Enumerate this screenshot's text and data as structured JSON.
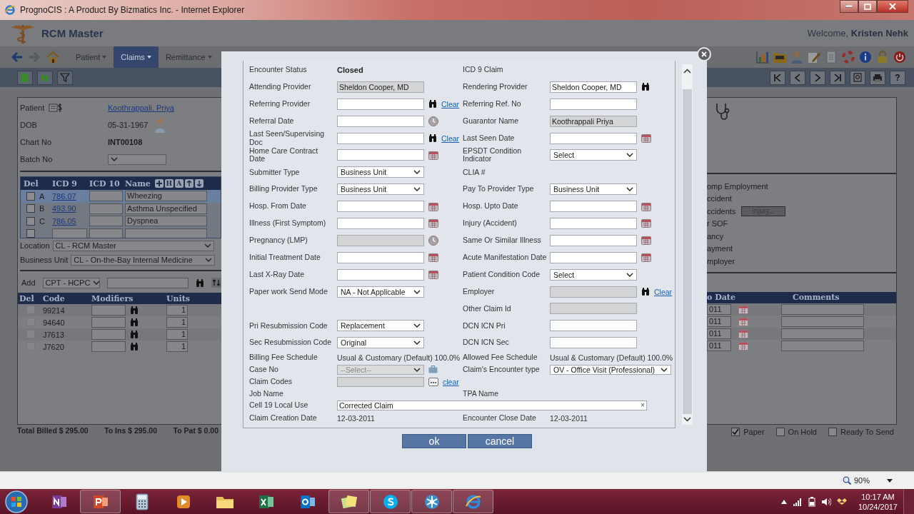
{
  "window": {
    "title": "PrognoCIS : A Product By Bizmatics Inc. - Internet Explorer"
  },
  "header": {
    "app_title": "RCM Master",
    "welcome": "Welcome, **Kristen Nehk**"
  },
  "menus": [
    {
      "label": "Patient",
      "selected": false
    },
    {
      "label": "Claims",
      "selected": true
    },
    {
      "label": "Remittance",
      "selected": false
    }
  ],
  "toolbar": {
    "help": "?"
  },
  "patient": {
    "fields": [
      {
        "label": "Patient",
        "kind": "link",
        "value": "Koothrappali, Priya"
      },
      {
        "label": "DOB",
        "kind": "text",
        "value": "05-31-1967"
      },
      {
        "label": "Chart No",
        "kind": "strong",
        "value": "INT00108"
      },
      {
        "label": "Batch No",
        "kind": "select"
      }
    ]
  },
  "diagnoses": {
    "columns": [
      "Del",
      "ICD 9",
      "ICD 10",
      "Name"
    ],
    "header_buttons": [
      "H",
      "A"
    ],
    "rows": [
      {
        "letter": "A",
        "code": "786.07",
        "name": "Wheezing",
        "selected": true,
        "checked": false
      },
      {
        "letter": "B",
        "code": "493.90",
        "name": "Asthma Unspecified",
        "selected": false,
        "checked": false
      },
      {
        "letter": "C",
        "code": "786.05",
        "name": "Dyspnea",
        "selected": false,
        "checked": false
      },
      {
        "selected": false,
        "checked": false
      }
    ]
  },
  "location": {
    "label": "Location",
    "value": "CL - RCM Master"
  },
  "business_unit": {
    "label": "Business Unit",
    "value": "CL - On-the-Bay Internal Medicine"
  },
  "add": {
    "label": "Add",
    "value": "CPT - HCPC"
  },
  "procedures": {
    "columns": [
      "Del",
      "Code",
      "Modifiers",
      "Units"
    ],
    "rows": [
      {
        "code": "99214",
        "units": "1",
        "checked": false
      },
      {
        "code": "94640",
        "units": "1",
        "checked": false
      },
      {
        "code": "J7613",
        "units": "1",
        "checked": false
      },
      {
        "code": "J7620",
        "units": "1",
        "checked": false
      }
    ]
  },
  "totals": [
    "Total Billed $ 295.00",
    "To Ins $ 295.00",
    "To Pat $ 0.00"
  ],
  "claim_info": {
    "items": [
      {
        "text": "omp Employment"
      },
      {
        "text": "ccident"
      },
      {
        "text": "ccidents",
        "button": "injury..."
      },
      {
        "text": "r SOF"
      },
      {
        "text": "ancy"
      },
      {
        "text": "ayment"
      },
      {
        "text": "mployer"
      }
    ]
  },
  "service_lines": {
    "columns": [
      "o Date",
      "Comments"
    ],
    "rows": [
      {
        "to_date": "011"
      },
      {
        "to_date": "011"
      },
      {
        "to_date": "011"
      },
      {
        "to_date": "011"
      }
    ]
  },
  "flags": [
    {
      "label": "Paper",
      "checked": true
    },
    {
      "label": "On Hold",
      "checked": false
    },
    {
      "label": "Ready To Send",
      "checked": false
    }
  ],
  "dialog": {
    "form": {
      "rows": [
        {
          "left": {
            "label": "Encounter Status",
            "kind": "strong",
            "value": "Closed"
          },
          "right": {
            "label": "ICD 9 Claim",
            "kind": "label"
          }
        },
        {
          "left": {
            "label": "Attending Provider",
            "kind": "input",
            "value": "Sheldon Cooper, MD",
            "disabled": true
          },
          "right": {
            "label": "Rendering Provider",
            "kind": "input",
            "value": "Sheldon Cooper, MD",
            "disabled": false,
            "lookup": true
          }
        },
        {
          "left": {
            "label": "Referring Provider",
            "kind": "input",
            "disabled": false,
            "lookup": true,
            "link": "Clear"
          },
          "right": {
            "label": "Referring Ref. No",
            "kind": "input",
            "disabled": false
          }
        },
        {
          "left": {
            "label": "Referral Date",
            "kind": "input",
            "disabled": false,
            "clock": true
          },
          "right": {
            "label": "Guarantor Name",
            "kind": "input",
            "value": "Koothrappali Priya",
            "disabled": true
          }
        },
        {
          "left": {
            "label": "Last Seen/Supervising Doc",
            "kind": "input",
            "disabled": false,
            "lookup": true,
            "link": "Clear"
          },
          "right": {
            "label": "Last Seen Date",
            "kind": "input",
            "disabled": false,
            "calendar": true
          }
        },
        {
          "left": {
            "label": "Home Care Contract Date",
            "kind": "input",
            "disabled": false,
            "calendar": true
          },
          "right": {
            "label": "EPSDT Condition Indicator",
            "kind": "select",
            "value": "Select",
            "disabled": false
          }
        },
        {
          "left": {
            "label": "Submitter Type",
            "kind": "select",
            "value": "Business Unit",
            "disabled": false
          },
          "right": {
            "label": "CLIA #",
            "kind": "label"
          }
        },
        {
          "left": {
            "label": "Billing Provider Type",
            "kind": "select",
            "value": "Business Unit",
            "disabled": false
          },
          "right": {
            "label": "Pay To Provider Type",
            "kind": "select",
            "value": "Business Unit",
            "disabled": false
          }
        },
        {
          "left": {
            "label": "Hosp. From Date",
            "kind": "input",
            "disabled": false,
            "calendar": true
          },
          "right": {
            "label": "Hosp. Upto Date",
            "kind": "input",
            "disabled": false,
            "calendar": true
          }
        },
        {
          "left": {
            "label": "Illness (First Symptom)",
            "kind": "input",
            "disabled": false,
            "calendar": true
          },
          "right": {
            "label": "Injury (Accident)",
            "kind": "input",
            "disabled": false,
            "calendar": true
          }
        },
        {
          "left": {
            "label": "Pregnancy (LMP)",
            "kind": "input",
            "disabled": true,
            "clock": true
          },
          "right": {
            "label": "Same Or Similar Illness",
            "kind": "input",
            "disabled": false,
            "calendar": true
          }
        },
        {
          "left": {
            "label": "Initial Treatment Date",
            "kind": "input",
            "disabled": false,
            "calendar": true
          },
          "right": {
            "label": "Acute Manifestation Date",
            "kind": "input",
            "disabled": false,
            "calendar": true
          }
        },
        {
          "left": {
            "label": "Last X-Ray Date",
            "kind": "input",
            "disabled": false,
            "calendar": true
          },
          "right": {
            "label": "Patient Condition Code",
            "kind": "select",
            "value": "Select",
            "disabled": false
          }
        },
        {
          "left": {
            "label": "Paper work Send Mode",
            "kind": "select",
            "value": "NA - Not Applicable",
            "disabled": false
          },
          "right": {
            "label": "Employer",
            "kind": "input",
            "disabled": true,
            "lookup": true,
            "link": "Clear"
          }
        },
        {
          "right": {
            "label": "Other Claim Id",
            "kind": "input",
            "disabled": true
          }
        },
        {
          "left": {
            "label": "Pri Resubmission Code",
            "kind": "select",
            "value": "Replacement",
            "disabled": false
          },
          "right": {
            "label": "DCN ICN Pri",
            "kind": "input",
            "disabled": false
          }
        },
        {
          "left": {
            "label": "Sec Resubmission Code",
            "kind": "select",
            "value": "Original",
            "disabled": false
          },
          "right": {
            "label": "DCN ICN Sec",
            "kind": "input",
            "disabled": false
          }
        }
      ],
      "summary_rows": [
        {
          "left": {
            "label": "Billing Fee Schedule",
            "kind": "static",
            "value": "Usual & Customary (Default) 100.0%"
          },
          "right": {
            "label": "Allowed Fee Schedule",
            "kind": "static",
            "value": "Usual & Customary (Default) 100.0%"
          }
        },
        {
          "left": {
            "label": "Case No",
            "kind": "select",
            "value": "--Select--",
            "disabled": true,
            "case_picker": true
          },
          "right": {
            "label": "Claim's Encounter type",
            "kind": "select",
            "value": "OV - Office Visit (Professional)",
            "disabled": false
          }
        },
        {
          "left": {
            "label": "Claim Codes",
            "kind": "input",
            "disabled": true,
            "code_picker": true,
            "link": "clear"
          }
        },
        {
          "left": {
            "label": "Job Name",
            "kind": "label"
          },
          "right": {
            "label": "TPA Name",
            "kind": "label"
          }
        },
        {
          "left": {
            "label": "Cell 19 Local Use",
            "kind": "wide_input",
            "value": "Corrected Claim",
            "clear": "×"
          }
        },
        {
          "left": {
            "label": "Claim Creation Date",
            "kind": "static",
            "value": "12-03-2011"
          },
          "right": {
            "label": "Encounter Close Date",
            "kind": "static",
            "value": "12-03-2011"
          }
        }
      ]
    },
    "buttons": [
      "ok",
      "cancel"
    ]
  },
  "status_bar": {
    "zoom": "90%"
  },
  "taskbar": {
    "apps": [
      {
        "kind": "onenote",
        "running": false
      },
      {
        "kind": "powerpoint",
        "running": true
      },
      {
        "kind": "calculator",
        "running": false
      },
      {
        "kind": "media",
        "running": false
      },
      {
        "kind": "explorer",
        "running": false
      },
      {
        "kind": "excel",
        "running": false
      },
      {
        "kind": "outlook",
        "running": false
      },
      {
        "kind": "notes",
        "running": true
      },
      {
        "kind": "skype",
        "running": true
      },
      {
        "kind": "snowflake",
        "running": true
      },
      {
        "kind": "browser",
        "running": true
      }
    ],
    "time": "10:17 AM",
    "date": "10/24/2017"
  }
}
